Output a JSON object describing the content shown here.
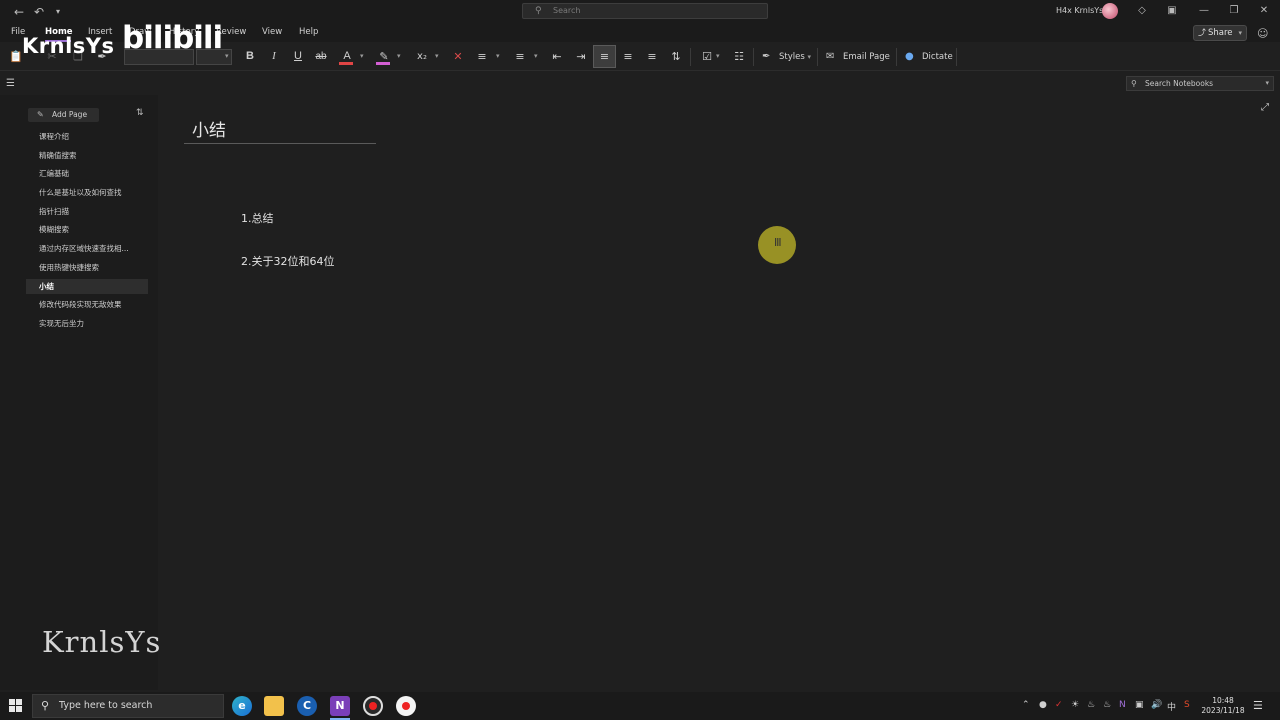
{
  "window": {
    "title": "小结 - OneNote",
    "search_placeholder": "Search",
    "user_name": "H4x KrnlsYs"
  },
  "menu": {
    "items": [
      "File",
      "Home",
      "Insert",
      "Draw",
      "History",
      "Review",
      "View",
      "Help"
    ],
    "active": "Home",
    "share_label": "Share"
  },
  "ribbon": {
    "bold": "B",
    "italic": "I",
    "underline": "U",
    "strikethrough": "ab",
    "font_color_glyph": "A",
    "styles_label": "Styles",
    "email_page_label": "Email Page",
    "dictate_label": "Dictate",
    "font_color": "#e04545",
    "highlight_color": "#d35fd3"
  },
  "navigation": {
    "search_notebooks_label": "Search Notebooks"
  },
  "pages": {
    "add_page_label": "Add Page",
    "items": [
      "课程介绍",
      "精确值搜索",
      "汇编基础",
      "什么是基址以及如何查找",
      "指针扫描",
      "模糊搜索",
      "通过内存区域快速查找相...",
      "使用热键快捷搜索",
      "小结",
      "修改代码段实现无敌效果",
      "实现无后坐力"
    ],
    "active_index": 8
  },
  "page": {
    "title": "小结",
    "lines": [
      "1.总结",
      "2.关于32位和64位"
    ]
  },
  "watermarks": {
    "top_left": "KrnlsYs",
    "bili": "bilibili",
    "bottom_left": "KrnlsYs"
  },
  "taskbar": {
    "search_label": "Type here to search",
    "time": "10:48",
    "date": "2023/11/18",
    "ime_label": "中"
  }
}
